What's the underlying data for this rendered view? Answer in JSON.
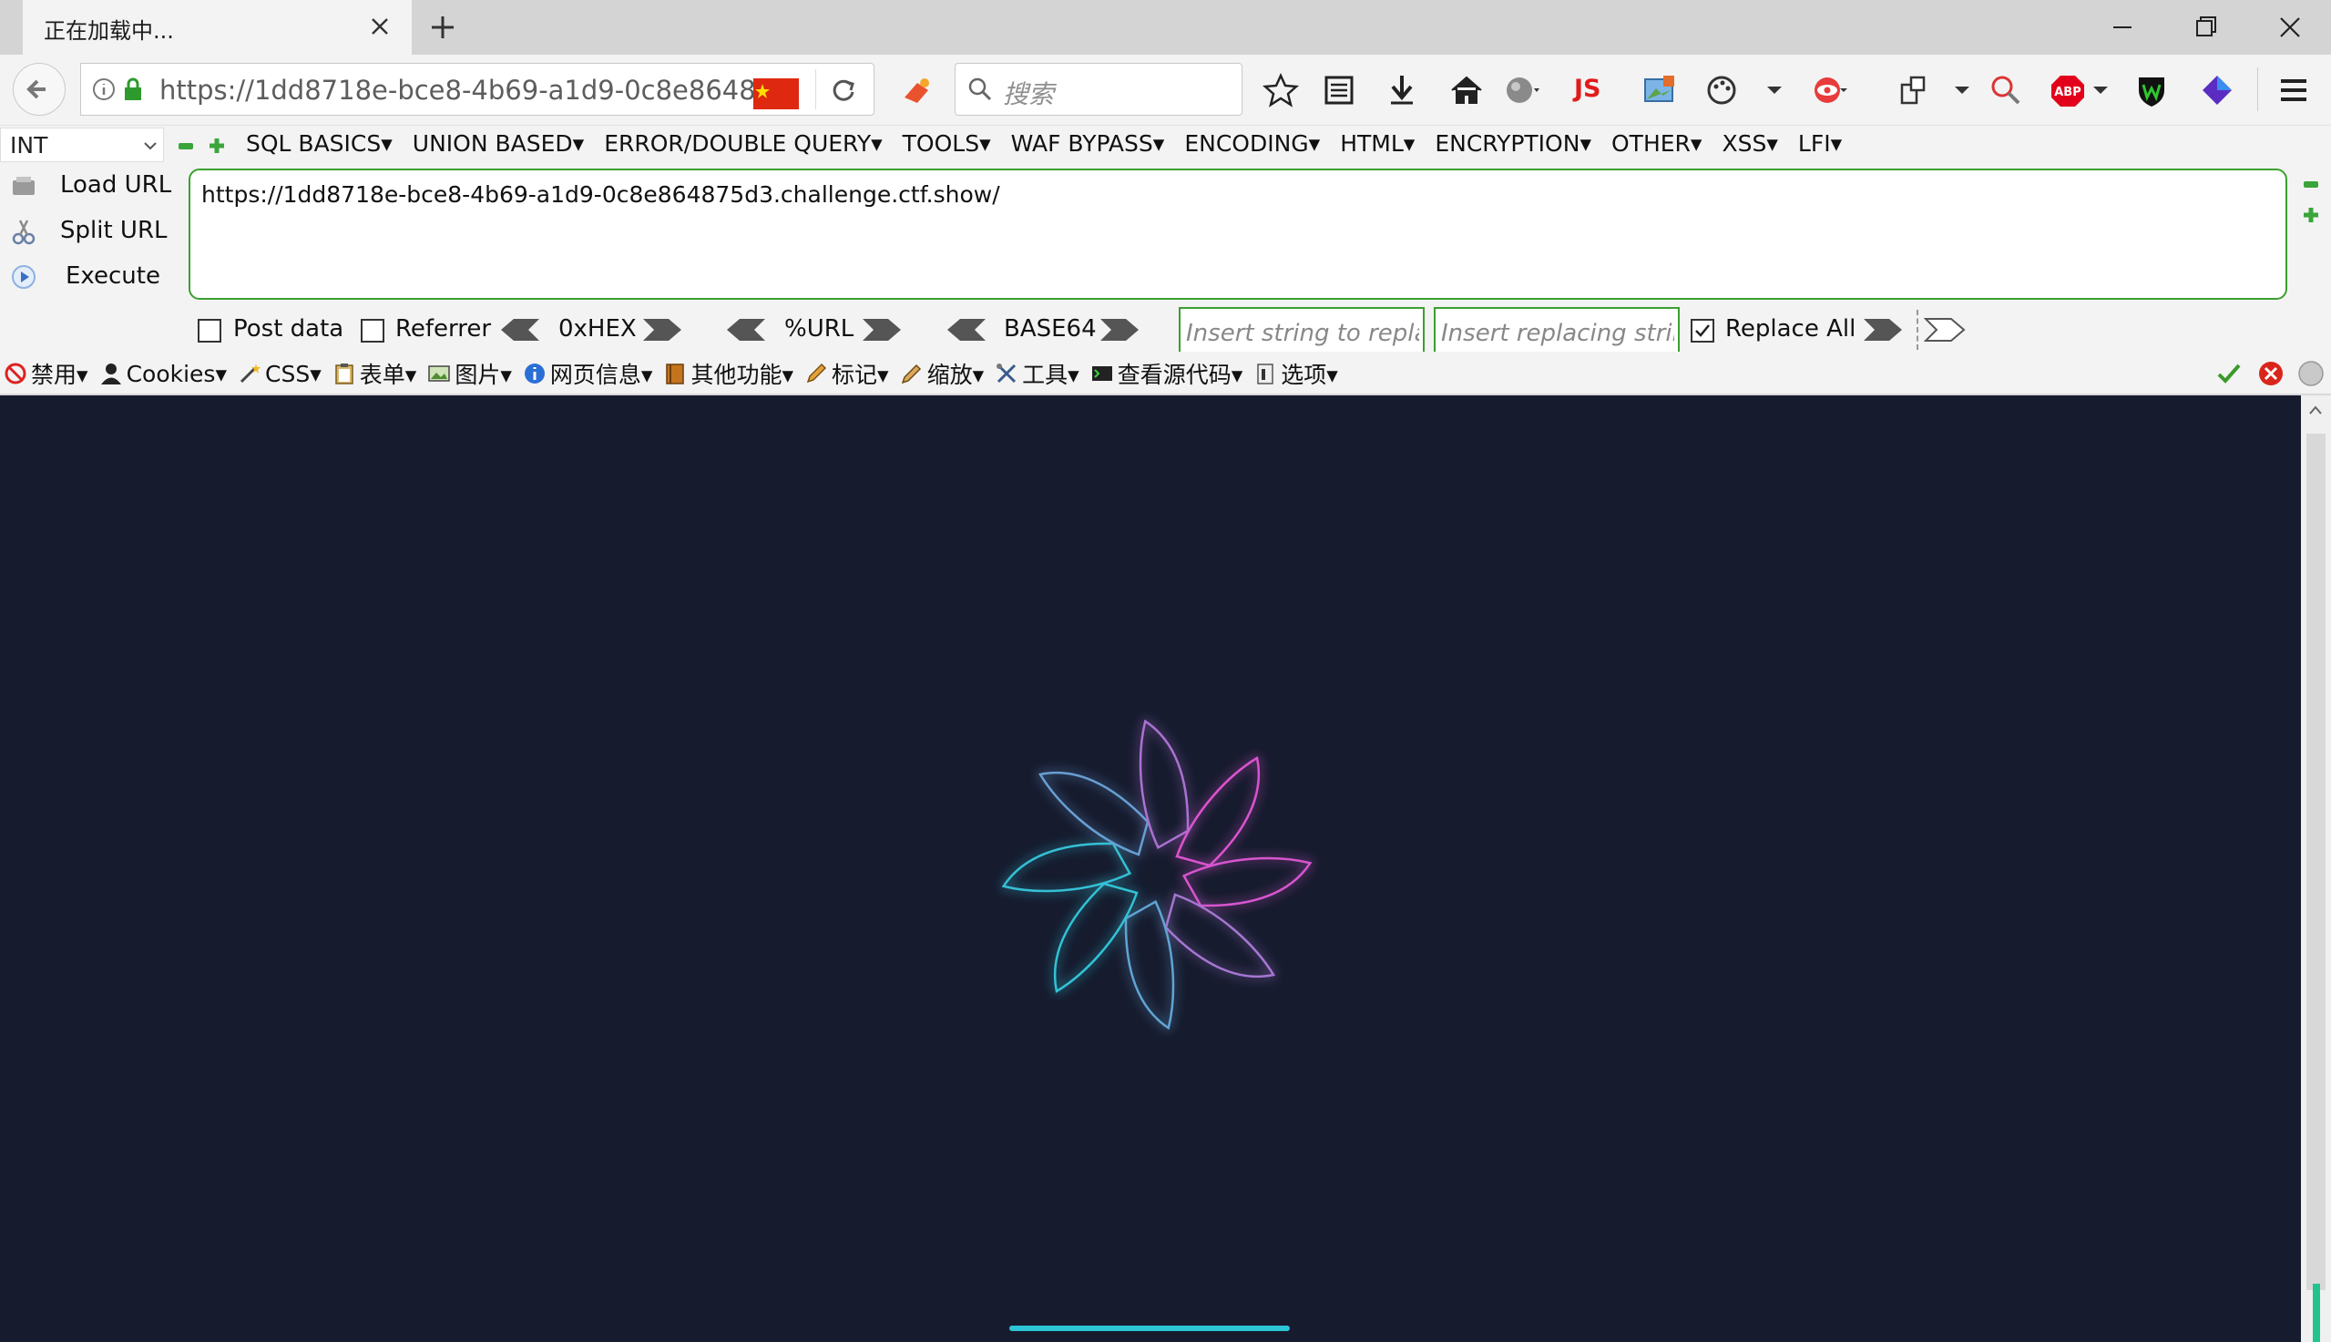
{
  "tab": {
    "title": "正在加载中..."
  },
  "nav": {
    "url": "https://1dd8718e-bce8-4b69-a1d9-0c8e8648",
    "search_placeholder": "搜索",
    "js_label": "JS",
    "abp_label": "ABP"
  },
  "hackbar": {
    "select_value": "INT",
    "menus": [
      "SQL BASICS▾",
      "UNION BASED▾",
      "ERROR/DOUBLE QUERY▾",
      "TOOLS▾",
      "WAF BYPASS▾",
      "ENCODING▾",
      "HTML▾",
      "ENCRYPTION▾",
      "OTHER▾",
      "XSS▾",
      "LFI▾"
    ],
    "load_url": "Load URL",
    "split_url": "Split URL",
    "execute": "Execute",
    "url_value": "https://1dd8718e-bce8-4b69-a1d9-0c8e864875d3.challenge.ctf.show/",
    "post_data": "Post data",
    "referrer": "Referrer",
    "hex": "0xHEX",
    "urlenc": "%URL",
    "base64": "BASE64",
    "replace_ph": "Insert string to replace",
    "replacing_ph": "Insert replacing string",
    "replace_all": "Replace All"
  },
  "webdev": {
    "items": [
      "禁用▾",
      "Cookies▾",
      "CSS▾",
      "表单▾",
      "图片▾",
      "网页信息▾",
      "其他功能▾",
      "标记▾",
      "缩放▾",
      "工具▾",
      "查看源代码▾",
      "选项▾"
    ]
  },
  "colors": {
    "page_bg": "#161b2e",
    "accent_green": "#3b9f2f",
    "loader_cyan": "#2cc6d6",
    "loader_pink": "#e04fd0"
  }
}
